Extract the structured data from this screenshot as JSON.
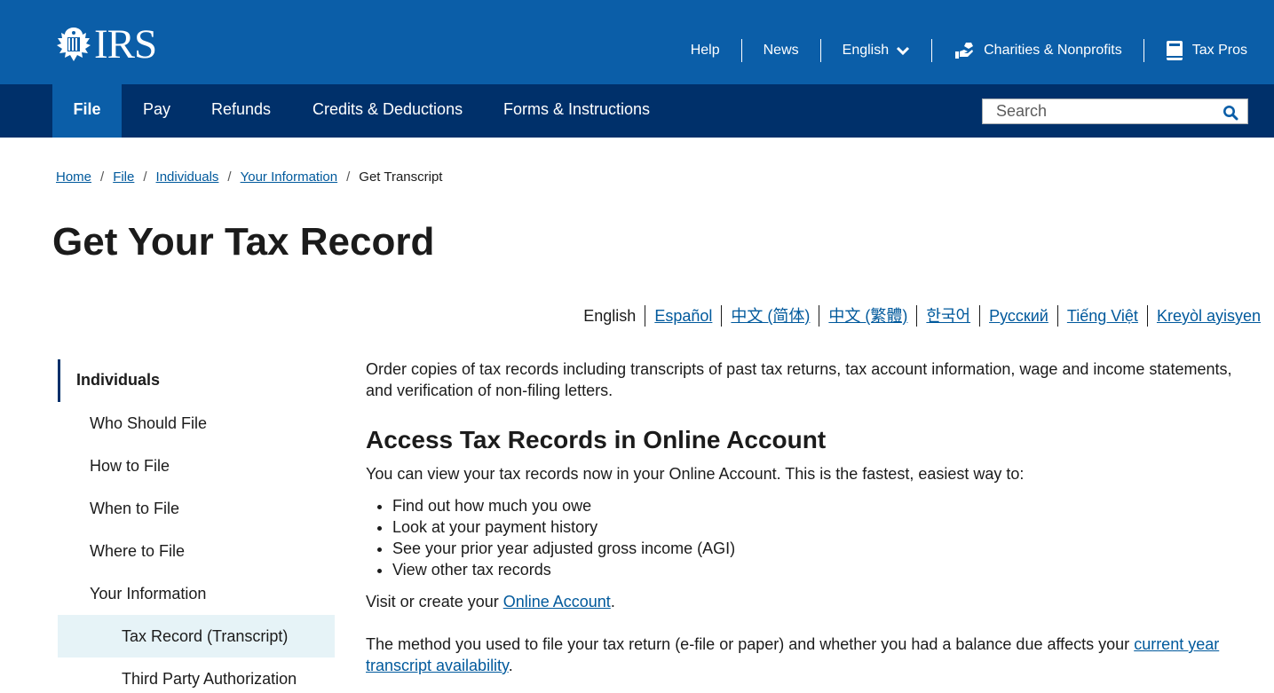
{
  "header": {
    "logo_text": "IRS",
    "utility_links": [
      {
        "label": "Help"
      },
      {
        "label": "News"
      },
      {
        "label": "English"
      },
      {
        "label": "Charities & Nonprofits"
      },
      {
        "label": "Tax Pros"
      }
    ]
  },
  "nav": {
    "tabs": [
      {
        "label": "File",
        "active": true
      },
      {
        "label": "Pay"
      },
      {
        "label": "Refunds"
      },
      {
        "label": "Credits & Deductions"
      },
      {
        "label": "Forms & Instructions"
      }
    ],
    "search_placeholder": "Search"
  },
  "breadcrumb": {
    "items": [
      "Home",
      "File",
      "Individuals",
      "Your Information"
    ],
    "current": "Get Transcript"
  },
  "page_title": "Get Your Tax Record",
  "languages": {
    "current": "English",
    "links": [
      "Español",
      "中文 (简体)",
      "中文 (繁體)",
      "한국어",
      "Русский",
      "Tiếng Việt",
      "Kreyòl ayisyen"
    ]
  },
  "sidebar": {
    "heading": "Individuals",
    "items": [
      "Who Should File",
      "How to File",
      "When to File",
      "Where to File",
      "Your Information"
    ],
    "subitems": [
      "Tax Record (Transcript)",
      "Third Party Authorization"
    ]
  },
  "content": {
    "intro": "Order copies of tax records including transcripts of past tax returns, tax account information, wage and income statements, and verification of non-filing letters.",
    "section_heading": "Access Tax Records in Online Account",
    "section_lead": "You can view your tax records now in your Online Account. This is the fastest, easiest way to:",
    "bullets": [
      "Find out how much you owe",
      "Look at your payment history",
      "See your prior year adjusted gross income (AGI)",
      "View other tax records"
    ],
    "visit_prefix": "Visit or create your ",
    "visit_link": "Online Account",
    "visit_suffix": ".",
    "method_text": "The method you used to file your tax return (e-file or paper) and whether you had a balance due affects  your ",
    "method_link": "current year transcript availability",
    "method_suffix": "."
  },
  "colors": {
    "header_blue": "#0b5ea8",
    "nav_dark": "#00306a",
    "link_blue": "#00599c",
    "sidebar_selected": "#e6f3f7"
  }
}
